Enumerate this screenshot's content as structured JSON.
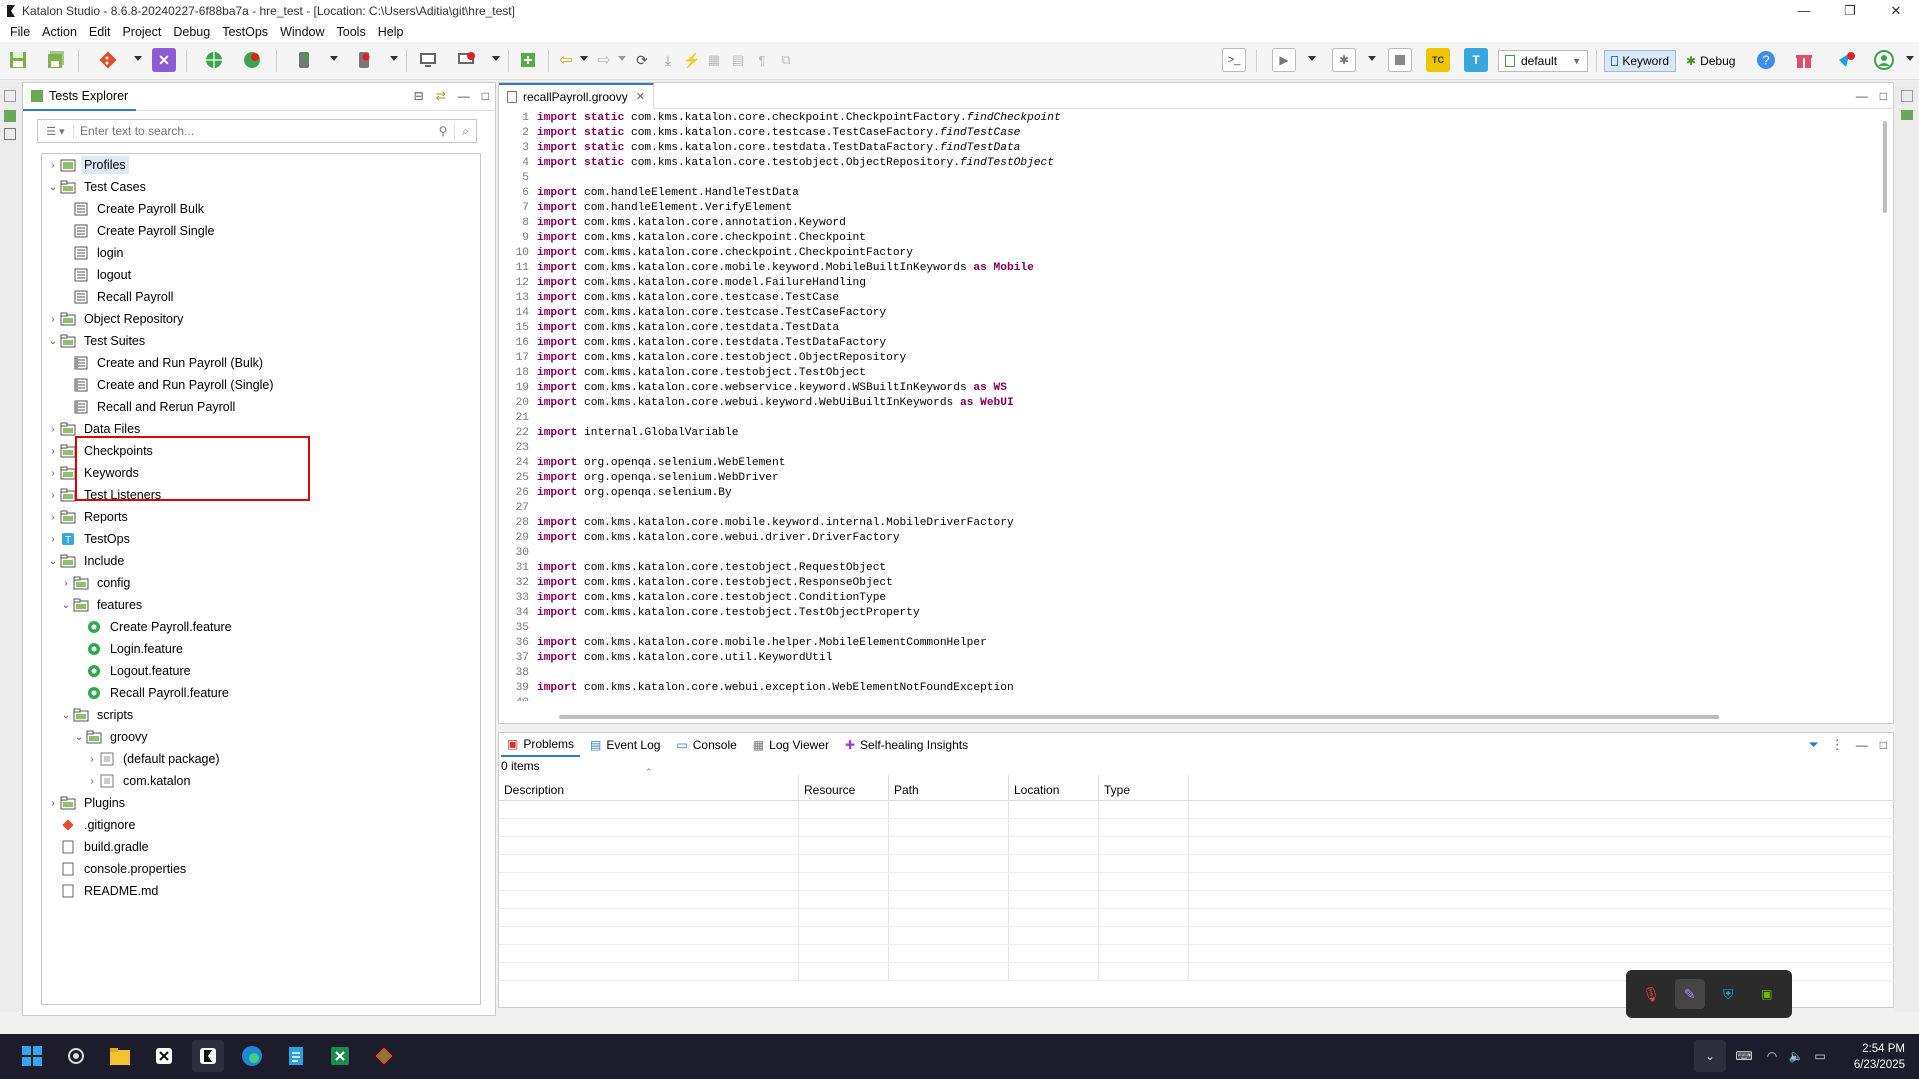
{
  "window": {
    "title": "Katalon Studio - 8.6.8-20240227-6f88ba7a - hre_test - [Location: C:\\Users\\Aditia\\git\\hre_test]",
    "minimize": "—",
    "maximize": "❐",
    "close": "✕"
  },
  "menu": [
    "File",
    "Action",
    "Edit",
    "Project",
    "Debug",
    "TestOps",
    "Window",
    "Tools",
    "Help"
  ],
  "toolbar": {
    "profile_selected": "default",
    "keyword_label": "Keyword",
    "debug_label": "Debug"
  },
  "explorer": {
    "tab_label": "Tests Explorer",
    "search_placeholder": "Enter text to search...",
    "tree": [
      {
        "label": "Profiles",
        "arrow": "›",
        "indent": 0,
        "icon": "folder-profile",
        "selected": true
      },
      {
        "label": "Test Cases",
        "arrow": "⌄",
        "indent": 0,
        "icon": "folder"
      },
      {
        "label": "Create Payroll Bulk",
        "arrow": "",
        "indent": 1,
        "icon": "test-case"
      },
      {
        "label": "Create Payroll Single",
        "arrow": "",
        "indent": 1,
        "icon": "test-case"
      },
      {
        "label": "login",
        "arrow": "",
        "indent": 1,
        "icon": "test-case"
      },
      {
        "label": "logout",
        "arrow": "",
        "indent": 1,
        "icon": "test-case"
      },
      {
        "label": "Recall Payroll",
        "arrow": "",
        "indent": 1,
        "icon": "test-case"
      },
      {
        "label": "Object Repository",
        "arrow": "›",
        "indent": 0,
        "icon": "folder"
      },
      {
        "label": "Test Suites",
        "arrow": "⌄",
        "indent": 0,
        "icon": "folder"
      },
      {
        "label": "Create and Run Payroll (Bulk)",
        "arrow": "",
        "indent": 1,
        "icon": "test-suite"
      },
      {
        "label": "Create and Run Payroll (Single)",
        "arrow": "",
        "indent": 1,
        "icon": "test-suite"
      },
      {
        "label": "Recall and Rerun Payroll",
        "arrow": "",
        "indent": 1,
        "icon": "test-suite"
      },
      {
        "label": "Data Files",
        "arrow": "›",
        "indent": 0,
        "icon": "folder"
      },
      {
        "label": "Checkpoints",
        "arrow": "›",
        "indent": 0,
        "icon": "folder"
      },
      {
        "label": "Keywords",
        "arrow": "›",
        "indent": 0,
        "icon": "folder"
      },
      {
        "label": "Test Listeners",
        "arrow": "›",
        "indent": 0,
        "icon": "folder"
      },
      {
        "label": "Reports",
        "arrow": "›",
        "indent": 0,
        "icon": "folder"
      },
      {
        "label": "TestOps",
        "arrow": "›",
        "indent": 0,
        "icon": "testops"
      },
      {
        "label": "Include",
        "arrow": "⌄",
        "indent": 0,
        "icon": "folder"
      },
      {
        "label": "config",
        "arrow": "›",
        "indent": 1,
        "icon": "folder"
      },
      {
        "label": "features",
        "arrow": "⌄",
        "indent": 1,
        "icon": "folder"
      },
      {
        "label": "Create Payroll.feature",
        "arrow": "",
        "indent": 2,
        "icon": "feature"
      },
      {
        "label": "Login.feature",
        "arrow": "",
        "indent": 2,
        "icon": "feature"
      },
      {
        "label": "Logout.feature",
        "arrow": "",
        "indent": 2,
        "icon": "feature"
      },
      {
        "label": "Recall Payroll.feature",
        "arrow": "",
        "indent": 2,
        "icon": "feature"
      },
      {
        "label": "scripts",
        "arrow": "⌄",
        "indent": 1,
        "icon": "folder"
      },
      {
        "label": "groovy",
        "arrow": "⌄",
        "indent": 2,
        "icon": "folder"
      },
      {
        "label": "(default package)",
        "arrow": "›",
        "indent": 3,
        "icon": "package"
      },
      {
        "label": "com.katalon",
        "arrow": "›",
        "indent": 3,
        "icon": "package"
      },
      {
        "label": "Plugins",
        "arrow": "›",
        "indent": 0,
        "icon": "folder"
      },
      {
        "label": ".gitignore",
        "arrow": "",
        "indent": 0,
        "icon": "git"
      },
      {
        "label": "build.gradle",
        "arrow": "",
        "indent": 0,
        "icon": "file"
      },
      {
        "label": "console.properties",
        "arrow": "",
        "indent": 0,
        "icon": "file"
      },
      {
        "label": "README.md",
        "arrow": "",
        "indent": 0,
        "icon": "file"
      }
    ]
  },
  "editor": {
    "tab_label": "recallPayroll.groovy",
    "lines": [
      {
        "n": "1",
        "kw": "import static",
        "rest": " com.kms.katalon.core.checkpoint.CheckpointFactory.",
        "it": "findCheckpoint",
        "tail": ""
      },
      {
        "n": "2",
        "kw": "import static",
        "rest": " com.kms.katalon.core.testcase.TestCaseFactory.",
        "it": "findTestCase",
        "tail": ""
      },
      {
        "n": "3",
        "kw": "import static",
        "rest": " com.kms.katalon.core.testdata.TestDataFactory.",
        "it": "findTestData",
        "tail": ""
      },
      {
        "n": "4",
        "kw": "import static",
        "rest": " com.kms.katalon.core.testobject.ObjectRepository.",
        "it": "findTestObject",
        "tail": ""
      },
      {
        "n": "5",
        "kw": "",
        "rest": "",
        "it": "",
        "tail": ""
      },
      {
        "n": "6",
        "kw": "import",
        "rest": " com.handleElement.HandleTestData",
        "it": "",
        "tail": ""
      },
      {
        "n": "7",
        "kw": "import",
        "rest": " com.handleElement.VerifyElement",
        "it": "",
        "tail": ""
      },
      {
        "n": "8",
        "kw": "import",
        "rest": " com.kms.katalon.core.annotation.Keyword",
        "it": "",
        "tail": ""
      },
      {
        "n": "9",
        "kw": "import",
        "rest": " com.kms.katalon.core.checkpoint.Checkpoint",
        "it": "",
        "tail": ""
      },
      {
        "n": "10",
        "kw": "import",
        "rest": " com.kms.katalon.core.checkpoint.CheckpointFactory",
        "it": "",
        "tail": ""
      },
      {
        "n": "11",
        "kw": "import",
        "rest": " com.kms.katalon.core.mobile.keyword.MobileBuiltInKeywords ",
        "it": "",
        "tail": "as Mobile"
      },
      {
        "n": "12",
        "kw": "import",
        "rest": " com.kms.katalon.core.model.FailureHandling",
        "it": "",
        "tail": ""
      },
      {
        "n": "13",
        "kw": "import",
        "rest": " com.kms.katalon.core.testcase.TestCase",
        "it": "",
        "tail": ""
      },
      {
        "n": "14",
        "kw": "import",
        "rest": " com.kms.katalon.core.testcase.TestCaseFactory",
        "it": "",
        "tail": ""
      },
      {
        "n": "15",
        "kw": "import",
        "rest": " com.kms.katalon.core.testdata.TestData",
        "it": "",
        "tail": ""
      },
      {
        "n": "16",
        "kw": "import",
        "rest": " com.kms.katalon.core.testdata.TestDataFactory",
        "it": "",
        "tail": ""
      },
      {
        "n": "17",
        "kw": "import",
        "rest": " com.kms.katalon.core.testobject.ObjectRepository",
        "it": "",
        "tail": ""
      },
      {
        "n": "18",
        "kw": "import",
        "rest": " com.kms.katalon.core.testobject.TestObject",
        "it": "",
        "tail": ""
      },
      {
        "n": "19",
        "kw": "import",
        "rest": " com.kms.katalon.core.webservice.keyword.WSBuiltInKeywords ",
        "it": "",
        "tail": "as WS"
      },
      {
        "n": "20",
        "kw": "import",
        "rest": " com.kms.katalon.core.webui.keyword.WebUiBuiltInKeywords ",
        "it": "",
        "tail": "as WebUI"
      },
      {
        "n": "21",
        "kw": "",
        "rest": "",
        "it": "",
        "tail": ""
      },
      {
        "n": "22",
        "kw": "import",
        "rest": " internal.GlobalVariable",
        "it": "",
        "tail": ""
      },
      {
        "n": "23",
        "kw": "",
        "rest": "",
        "it": "",
        "tail": ""
      },
      {
        "n": "24",
        "kw": "import",
        "rest": " org.openqa.selenium.WebElement",
        "it": "",
        "tail": ""
      },
      {
        "n": "25",
        "kw": "import",
        "rest": " org.openqa.selenium.WebDriver",
        "it": "",
        "tail": ""
      },
      {
        "n": "26",
        "kw": "import",
        "rest": " org.openqa.selenium.By",
        "it": "",
        "tail": ""
      },
      {
        "n": "27",
        "kw": "",
        "rest": "",
        "it": "",
        "tail": ""
      },
      {
        "n": "28",
        "kw": "import",
        "rest": " com.kms.katalon.core.mobile.keyword.internal.MobileDriverFactory",
        "it": "",
        "tail": ""
      },
      {
        "n": "29",
        "kw": "import",
        "rest": " com.kms.katalon.core.webui.driver.DriverFactory",
        "it": "",
        "tail": ""
      },
      {
        "n": "30",
        "kw": "",
        "rest": "",
        "it": "",
        "tail": ""
      },
      {
        "n": "31",
        "kw": "import",
        "rest": " com.kms.katalon.core.testobject.RequestObject",
        "it": "",
        "tail": ""
      },
      {
        "n": "32",
        "kw": "import",
        "rest": " com.kms.katalon.core.testobject.ResponseObject",
        "it": "",
        "tail": ""
      },
      {
        "n": "33",
        "kw": "import",
        "rest": " com.kms.katalon.core.testobject.ConditionType",
        "it": "",
        "tail": ""
      },
      {
        "n": "34",
        "kw": "import",
        "rest": " com.kms.katalon.core.testobject.TestObjectProperty",
        "it": "",
        "tail": ""
      },
      {
        "n": "35",
        "kw": "",
        "rest": "",
        "it": "",
        "tail": ""
      },
      {
        "n": "36",
        "kw": "import",
        "rest": " com.kms.katalon.core.mobile.helper.MobileElementCommonHelper",
        "it": "",
        "tail": ""
      },
      {
        "n": "37",
        "kw": "import",
        "rest": " com.kms.katalon.core.util.KeywordUtil",
        "it": "",
        "tail": ""
      },
      {
        "n": "38",
        "kw": "",
        "rest": "",
        "it": "",
        "tail": ""
      },
      {
        "n": "39",
        "kw": "import",
        "rest": " com.kms.katalon.core.webui.exception.WebElementNotFoundException",
        "it": "",
        "tail": ""
      },
      {
        "n": "40",
        "kw": "",
        "rest": "",
        "it": "",
        "tail": ""
      }
    ]
  },
  "bottom": {
    "tabs": [
      "Problems",
      "Event Log",
      "Console",
      "Log Viewer",
      "Self-healing Insights"
    ],
    "items_count": "0 items",
    "columns": [
      "Description",
      "Resource",
      "Path",
      "Location",
      "Type"
    ]
  },
  "taskbar": {
    "time": "2:54 PM",
    "date": "6/23/2025"
  }
}
